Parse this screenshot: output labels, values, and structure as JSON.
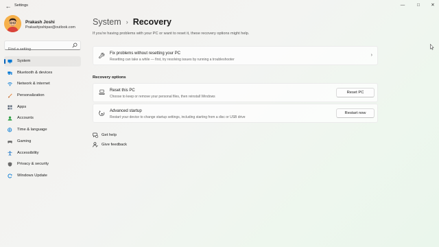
{
  "window": {
    "title": "Settings",
    "back_icon": "back-arrow-icon",
    "controls": [
      "minimize-icon",
      "maximize-icon",
      "close-icon"
    ]
  },
  "profile": {
    "name": "Prakash Joshi",
    "email": "Prakashjoshipax@outlook.com"
  },
  "search": {
    "placeholder": "Find a setting",
    "icon": "search-icon"
  },
  "sidebar": {
    "items": [
      {
        "label": "System",
        "icon": "system-icon",
        "active": true,
        "color": "#0078d4"
      },
      {
        "label": "Bluetooth & devices",
        "icon": "bluetooth-icon",
        "color": "#0078d4"
      },
      {
        "label": "Network & internet",
        "icon": "wifi-icon",
        "color": "#0078d4"
      },
      {
        "label": "Personalization",
        "icon": "brush-icon",
        "color": "#e3843a"
      },
      {
        "label": "Apps",
        "icon": "apps-icon",
        "color": "#5e6a7a"
      },
      {
        "label": "Accounts",
        "icon": "accounts-icon",
        "color": "#2ea043"
      },
      {
        "label": "Time & language",
        "icon": "globe-clock-icon",
        "color": "#0078d4"
      },
      {
        "label": "Gaming",
        "icon": "gaming-icon",
        "color": "#6b6b6b"
      },
      {
        "label": "Accessibility",
        "icon": "accessibility-icon",
        "color": "#1a73c8"
      },
      {
        "label": "Privacy & security",
        "icon": "shield-icon",
        "color": "#6b6b6b"
      },
      {
        "label": "Windows Update",
        "icon": "update-icon",
        "color": "#0078d4"
      }
    ]
  },
  "main": {
    "breadcrumb": {
      "parent": "System",
      "separator": "›",
      "current": "Recovery"
    },
    "intro": "If you're having problems with your PC or want to reset it, these recovery options might help.",
    "fix_card": {
      "title": "Fix problems without resetting your PC",
      "description": "Resetting can take a while — first, try resolving issues by running a troubleshooter",
      "icon": "wrench-icon",
      "chevron": "›"
    },
    "section_title": "Recovery options",
    "options": [
      {
        "title": "Reset this PC",
        "description": "Choose to keep or remove your personal files, then reinstall Windows",
        "button": "Reset PC",
        "icon": "reset-pc-icon"
      },
      {
        "title": "Advanced startup",
        "description": "Restart your device to change startup settings, including starting from a disc or USB drive",
        "button": "Restart now",
        "icon": "advanced-startup-icon"
      }
    ],
    "links": [
      {
        "label": "Get help",
        "icon": "help-icon"
      },
      {
        "label": "Give feedback",
        "icon": "feedback-icon"
      }
    ]
  },
  "colors": {
    "accent": "#005fb8",
    "background_start": "#f3f1ef",
    "background_end": "#eaf6ec"
  }
}
